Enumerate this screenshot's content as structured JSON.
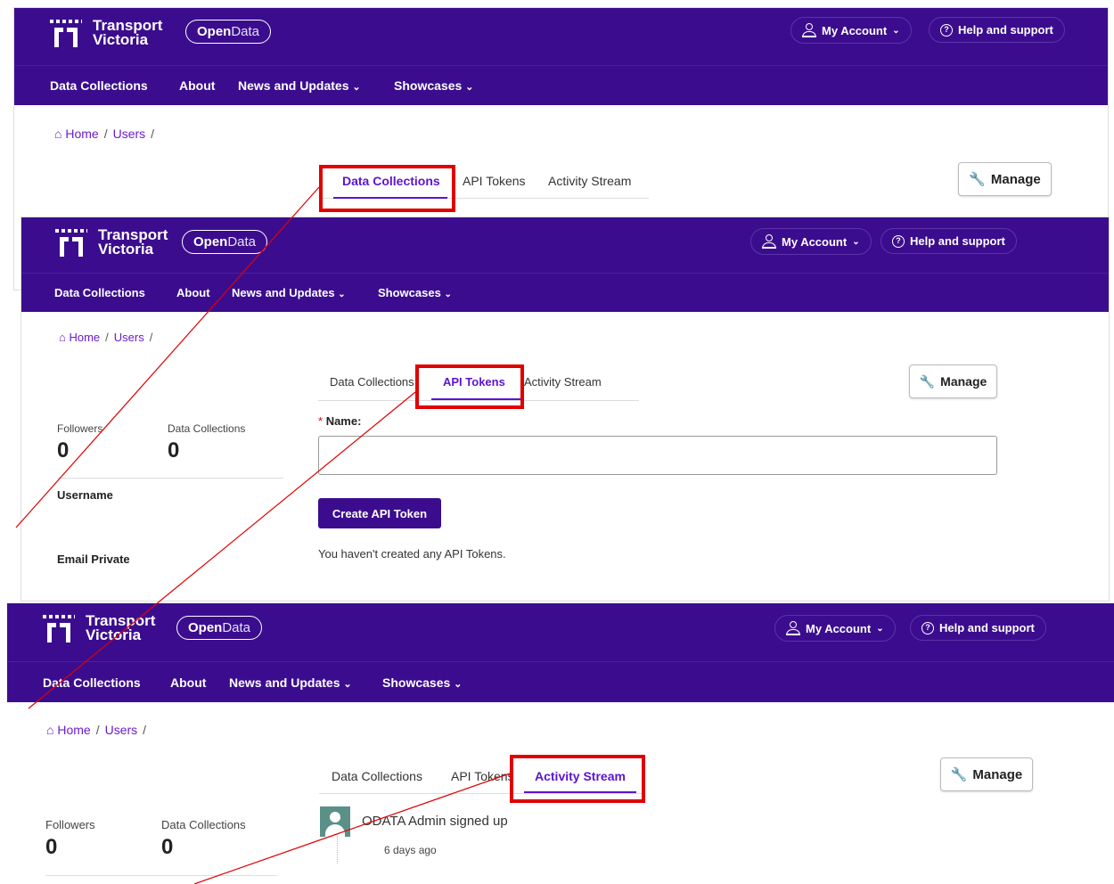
{
  "brand": {
    "line1": "Transport",
    "line2": "Victoria",
    "pill_bold": "Open",
    "pill_light": "Data"
  },
  "header": {
    "my_account": "My Account",
    "help": "Help and support",
    "chevron": "⌄"
  },
  "nav": {
    "data_collections": "Data Collections",
    "about": "About",
    "news": "News and Updates",
    "showcases": "Showcases"
  },
  "breadcrumb": {
    "home": "Home",
    "users": "Users",
    "sep": "/"
  },
  "tabs": {
    "data_collections": "Data Collections",
    "api_tokens": "API Tokens",
    "activity_stream": "Activity Stream"
  },
  "manage_label": "Manage",
  "profile": {
    "followers_label": "Followers",
    "followers_value": "0",
    "collections_label": "Data Collections",
    "collections_value": "0",
    "username_label": "Username",
    "email_label": "Email Private"
  },
  "api_form": {
    "required_mark": "*",
    "name_label": "Name:",
    "name_value": "",
    "create_button": "Create API Token",
    "empty_message": "You haven't created any API Tokens."
  },
  "activity": {
    "entry": "ODATA Admin signed up",
    "time": "6 days ago"
  },
  "colors": {
    "brand_purple": "#3b0d8e",
    "accent": "#5a14d0",
    "annotation_red": "#e00000"
  }
}
